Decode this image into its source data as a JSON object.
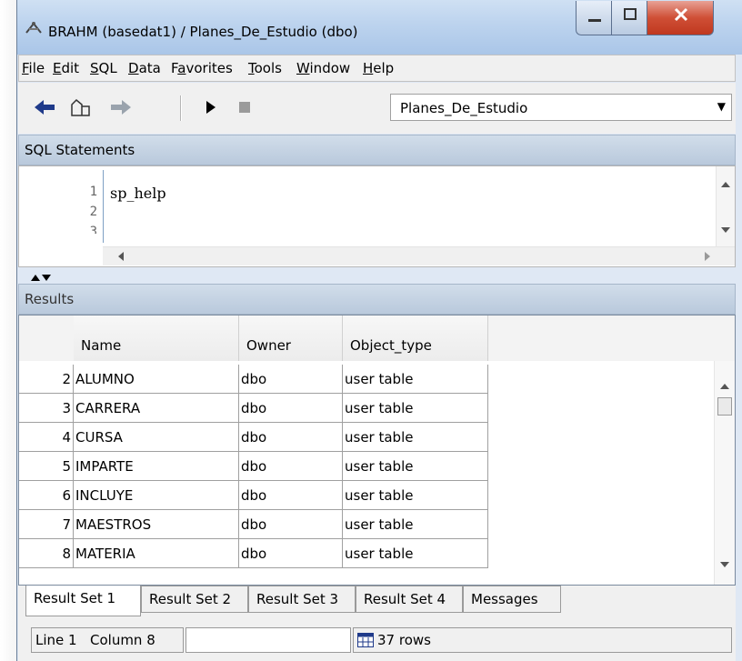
{
  "window": {
    "title": "BRAHM (basedat1) / Planes_De_Estudio (dbo)"
  },
  "menu": {
    "items": [
      {
        "label": "File",
        "key": "F",
        "rest": "ile"
      },
      {
        "label": "Edit",
        "key": "E",
        "rest": "dit"
      },
      {
        "label": "SQL",
        "key": "S",
        "rest": "QL"
      },
      {
        "label": "Data",
        "key": "D",
        "rest": "ata"
      },
      {
        "label": "Favorites",
        "key": "a",
        "pre": "F",
        "rest": "vorites"
      },
      {
        "label": "Tools",
        "key": "T",
        "rest": "ools"
      },
      {
        "label": "Window",
        "key": "W",
        "rest": "indow"
      },
      {
        "label": "Help",
        "key": "H",
        "rest": "elp"
      }
    ]
  },
  "toolbar": {
    "icons": [
      "back-arrow-icon",
      "database-icon",
      "forward-arrow-icon",
      "run-icon",
      "stop-icon"
    ],
    "database_select": "Planes_De_Estudio"
  },
  "sql_panel": {
    "header": "SQL Statements",
    "line_numbers": [
      "1",
      "2",
      "3"
    ],
    "code": "sp_help"
  },
  "results_panel": {
    "header": "Results",
    "columns": [
      "Name",
      "Owner",
      "Object_type"
    ],
    "rows": [
      {
        "num": "2",
        "name": "ALUMNO",
        "owner": "dbo",
        "type": "user table"
      },
      {
        "num": "3",
        "name": "CARRERA",
        "owner": "dbo",
        "type": "user table"
      },
      {
        "num": "4",
        "name": "CURSA",
        "owner": "dbo",
        "type": "user table"
      },
      {
        "num": "5",
        "name": "IMPARTE",
        "owner": "dbo",
        "type": "user table"
      },
      {
        "num": "6",
        "name": "INCLUYE",
        "owner": "dbo",
        "type": "user table"
      },
      {
        "num": "7",
        "name": "MAESTROS",
        "owner": "dbo",
        "type": "user table"
      },
      {
        "num": "8",
        "name": "MATERIA",
        "owner": "dbo",
        "type": "user table"
      }
    ]
  },
  "tabs": [
    "Result Set 1",
    "Result Set 2",
    "Result Set 3",
    "Result Set 4",
    "Messages"
  ],
  "status": {
    "line_label": "Line 1",
    "column_label": "Column 8",
    "rows_label": "37 rows"
  },
  "colors": {
    "panel_header": "#b9c9dc",
    "title_bar": "#bcd3ee",
    "close_button": "#cf4f36"
  }
}
